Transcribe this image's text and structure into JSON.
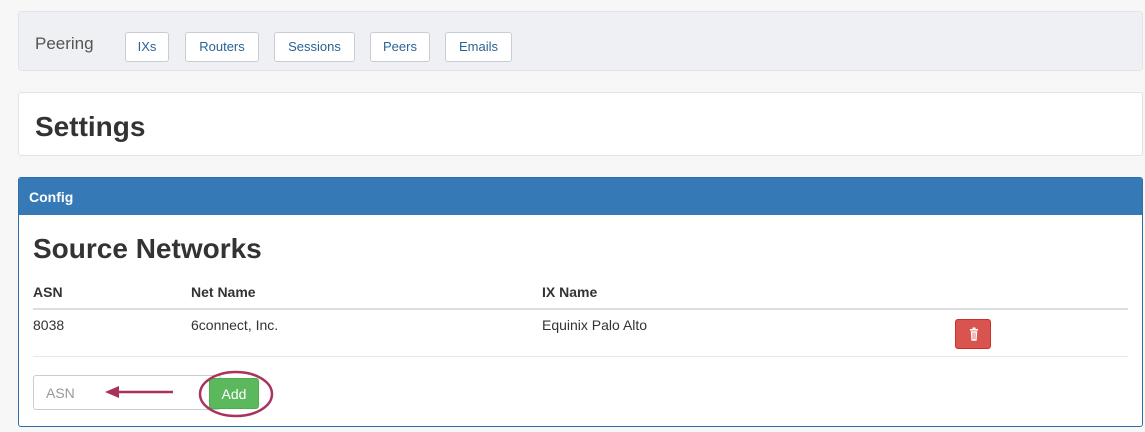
{
  "nav": {
    "brand": "Peering",
    "buttons": [
      "IXs",
      "Routers",
      "Sessions",
      "Peers",
      "Emails"
    ]
  },
  "settings": {
    "title": "Settings"
  },
  "config": {
    "heading": "Config",
    "section_title": "Source Networks",
    "columns": [
      "ASN",
      "Net Name",
      "IX Name"
    ],
    "rows": [
      {
        "asn": "8038",
        "net_name": "6connect, Inc.",
        "ix_name": "Equinix Palo Alto"
      }
    ],
    "input": {
      "placeholder": "ASN",
      "value": ""
    },
    "add_label": "Add"
  },
  "icons": {
    "delete": "trash-icon"
  },
  "colors": {
    "panel_heading": "#357ab7",
    "add_button": "#5cb85c",
    "delete_button": "#d9534f",
    "annotation": "#a8345e"
  }
}
